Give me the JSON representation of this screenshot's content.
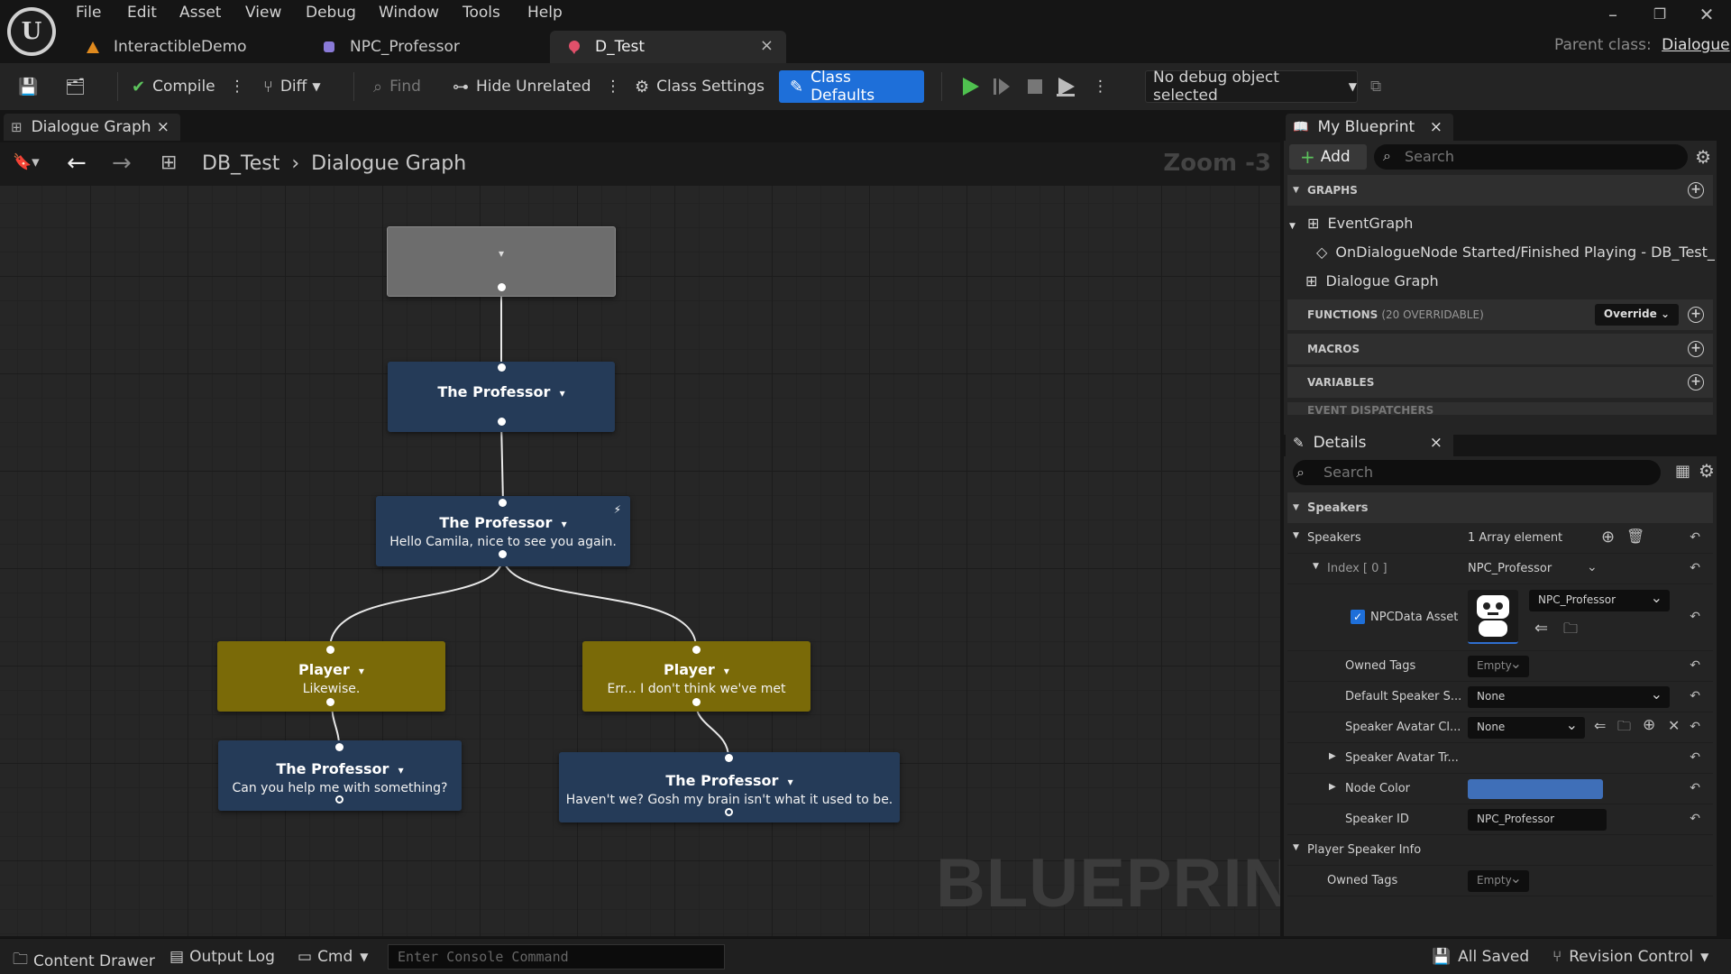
{
  "menu": [
    "File",
    "Edit",
    "Asset",
    "View",
    "Debug",
    "Window",
    "Tools",
    "Help"
  ],
  "tabs": [
    {
      "label": "InteractibleDemo"
    },
    {
      "label": "NPC_Professor"
    },
    {
      "label": "D_Test",
      "active": true
    }
  ],
  "parent_class": {
    "label": "Parent class:",
    "value": "Dialogue"
  },
  "toolbar": {
    "compile": "Compile",
    "diff": "Diff",
    "find": "Find",
    "hide_unrelated": "Hide Unrelated",
    "class_settings": "Class Settings",
    "class_defaults": "Class Defaults",
    "debug_object": "No debug object selected"
  },
  "graph": {
    "tab_label": "Dialogue Graph",
    "breadcrumb_root": "DB_Test",
    "breadcrumb_sep": "›",
    "breadcrumb_leaf": "Dialogue Graph",
    "zoom": "Zoom -3",
    "watermark": "BLUEPRINT",
    "nodes": [
      {
        "speaker": "The Professor",
        "line": ""
      },
      {
        "speaker": "The Professor",
        "line": "Hello Camila, nice to see you again."
      },
      {
        "speaker": "Player",
        "line": "Likewise."
      },
      {
        "speaker": "Player",
        "line": "Err... I don't think we've met"
      },
      {
        "speaker": "The Professor",
        "line": "Can you help me with something?"
      },
      {
        "speaker": "The Professor",
        "line": "Haven't we? Gosh my brain isn't what it used to be."
      }
    ]
  },
  "my_blueprint": {
    "title": "My Blueprint",
    "add": "Add",
    "search_placeholder": "Search",
    "sections": {
      "graphs": "GRAPHS",
      "functions": "FUNCTIONS",
      "functions_note": "(20 OVERRIDABLE)",
      "override": "Override",
      "macros": "MACROS",
      "variables": "VARIABLES",
      "event_dispatchers": "EVENT DISPATCHERS"
    },
    "graph_items": {
      "event_graph": "EventGraph",
      "event": "OnDialogueNode Started/Finished Playing - DB_Test_",
      "dialogue_graph": "Dialogue Graph"
    }
  },
  "details": {
    "title": "Details",
    "search_placeholder": "Search",
    "category_speakers": "Speakers",
    "speakers_label": "Speakers",
    "speakers_value": "1 Array element",
    "index_label": "Index [ 0 ]",
    "index_value": "NPC_Professor",
    "npc_asset_label": "NPCData Asset",
    "npc_asset_value": "NPC_Professor",
    "owned_tags_label": "Owned Tags",
    "owned_tags_value": "Empty",
    "default_speaker_label": "Default Speaker S...",
    "default_speaker_value": "None",
    "avatar_class_label": "Speaker Avatar Cl...",
    "avatar_class_value": "None",
    "avatar_tr_label": "Speaker Avatar Tr...",
    "node_color_label": "Node Color",
    "node_color": "#3f6fb8",
    "speaker_id_label": "Speaker ID",
    "speaker_id_value": "NPC_Professor",
    "player_info_label": "Player Speaker Info",
    "player_owned_tags_label": "Owned Tags",
    "player_owned_tags_value": "Empty"
  },
  "statusbar": {
    "content_drawer": "Content Drawer",
    "output_log": "Output Log",
    "cmd": "Cmd",
    "console_placeholder": "Enter Console Command",
    "all_saved": "All Saved",
    "revision_control": "Revision Control"
  }
}
